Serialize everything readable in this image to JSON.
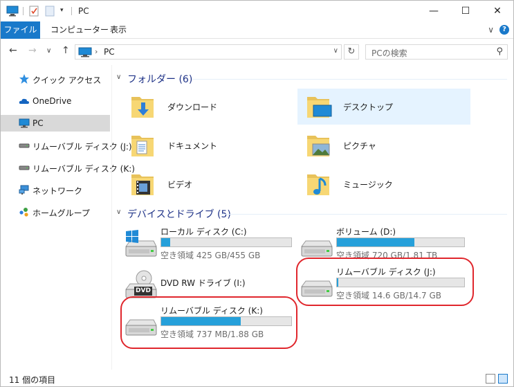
{
  "titlebar": {
    "title": "PC",
    "minimize": "—",
    "maximize": "☐",
    "close": "✕"
  },
  "ribbon": {
    "tabs": [
      {
        "label": "ファイル"
      },
      {
        "label": "コンピューター"
      },
      {
        "label": "表示"
      }
    ],
    "toggle": "∨",
    "help": "?"
  },
  "nav": {
    "back": "←",
    "forward": "→",
    "recent": "∨",
    "up": "↑",
    "breadcrumb": "PC",
    "refresh": "↻",
    "search_placeholder": "PCの検索"
  },
  "sidebar": {
    "items": [
      {
        "label": "クイック アクセス",
        "icon": "star-icon"
      },
      {
        "label": "OneDrive",
        "icon": "cloud-icon"
      },
      {
        "label": "PC",
        "icon": "computer-icon"
      },
      {
        "label": "リムーバブル ディスク (J:)",
        "icon": "usb-drive-icon"
      },
      {
        "label": "リムーバブル ディスク (K:)",
        "icon": "usb-drive-icon"
      },
      {
        "label": "ネットワーク",
        "icon": "network-icon"
      },
      {
        "label": "ホームグループ",
        "icon": "homegroup-icon"
      }
    ]
  },
  "folders": {
    "header": "フォルダー (6)",
    "items": [
      {
        "label": "ダウンロード",
        "icon": "downloads-folder-icon"
      },
      {
        "label": "デスクトップ",
        "icon": "desktop-folder-icon"
      },
      {
        "label": "ドキュメント",
        "icon": "documents-folder-icon"
      },
      {
        "label": "ピクチャ",
        "icon": "pictures-folder-icon"
      },
      {
        "label": "ビデオ",
        "icon": "videos-folder-icon"
      },
      {
        "label": "ミュージック",
        "icon": "music-folder-icon"
      }
    ]
  },
  "drives": {
    "header": "デバイスとドライブ (5)",
    "items": [
      {
        "label": "ローカル ディスク (C:)",
        "info": "空き領域 425 GB/455 GB",
        "used_fraction": 0.07
      },
      {
        "label": "ボリューム (D:)",
        "info": "空き領域 720 GB/1.81 TB",
        "used_fraction": 0.61
      },
      {
        "label": "DVD RW ドライブ (I:)",
        "info": "",
        "dvd_label": "DVD"
      },
      {
        "label": "リムーバブル ディスク (J:)",
        "info": "空き領域 14.6 GB/14.7 GB",
        "used_fraction": 0.01
      },
      {
        "label": "リムーバブル ディスク (K:)",
        "info": "空き領域 737 MB/1.88 GB",
        "used_fraction": 0.61
      }
    ]
  },
  "status": {
    "count": "11 個の項目"
  },
  "colors": {
    "accent": "#1979ca",
    "bar_fill": "#26a0da",
    "highlight": "#e0262c",
    "header_text": "#1e3287"
  }
}
